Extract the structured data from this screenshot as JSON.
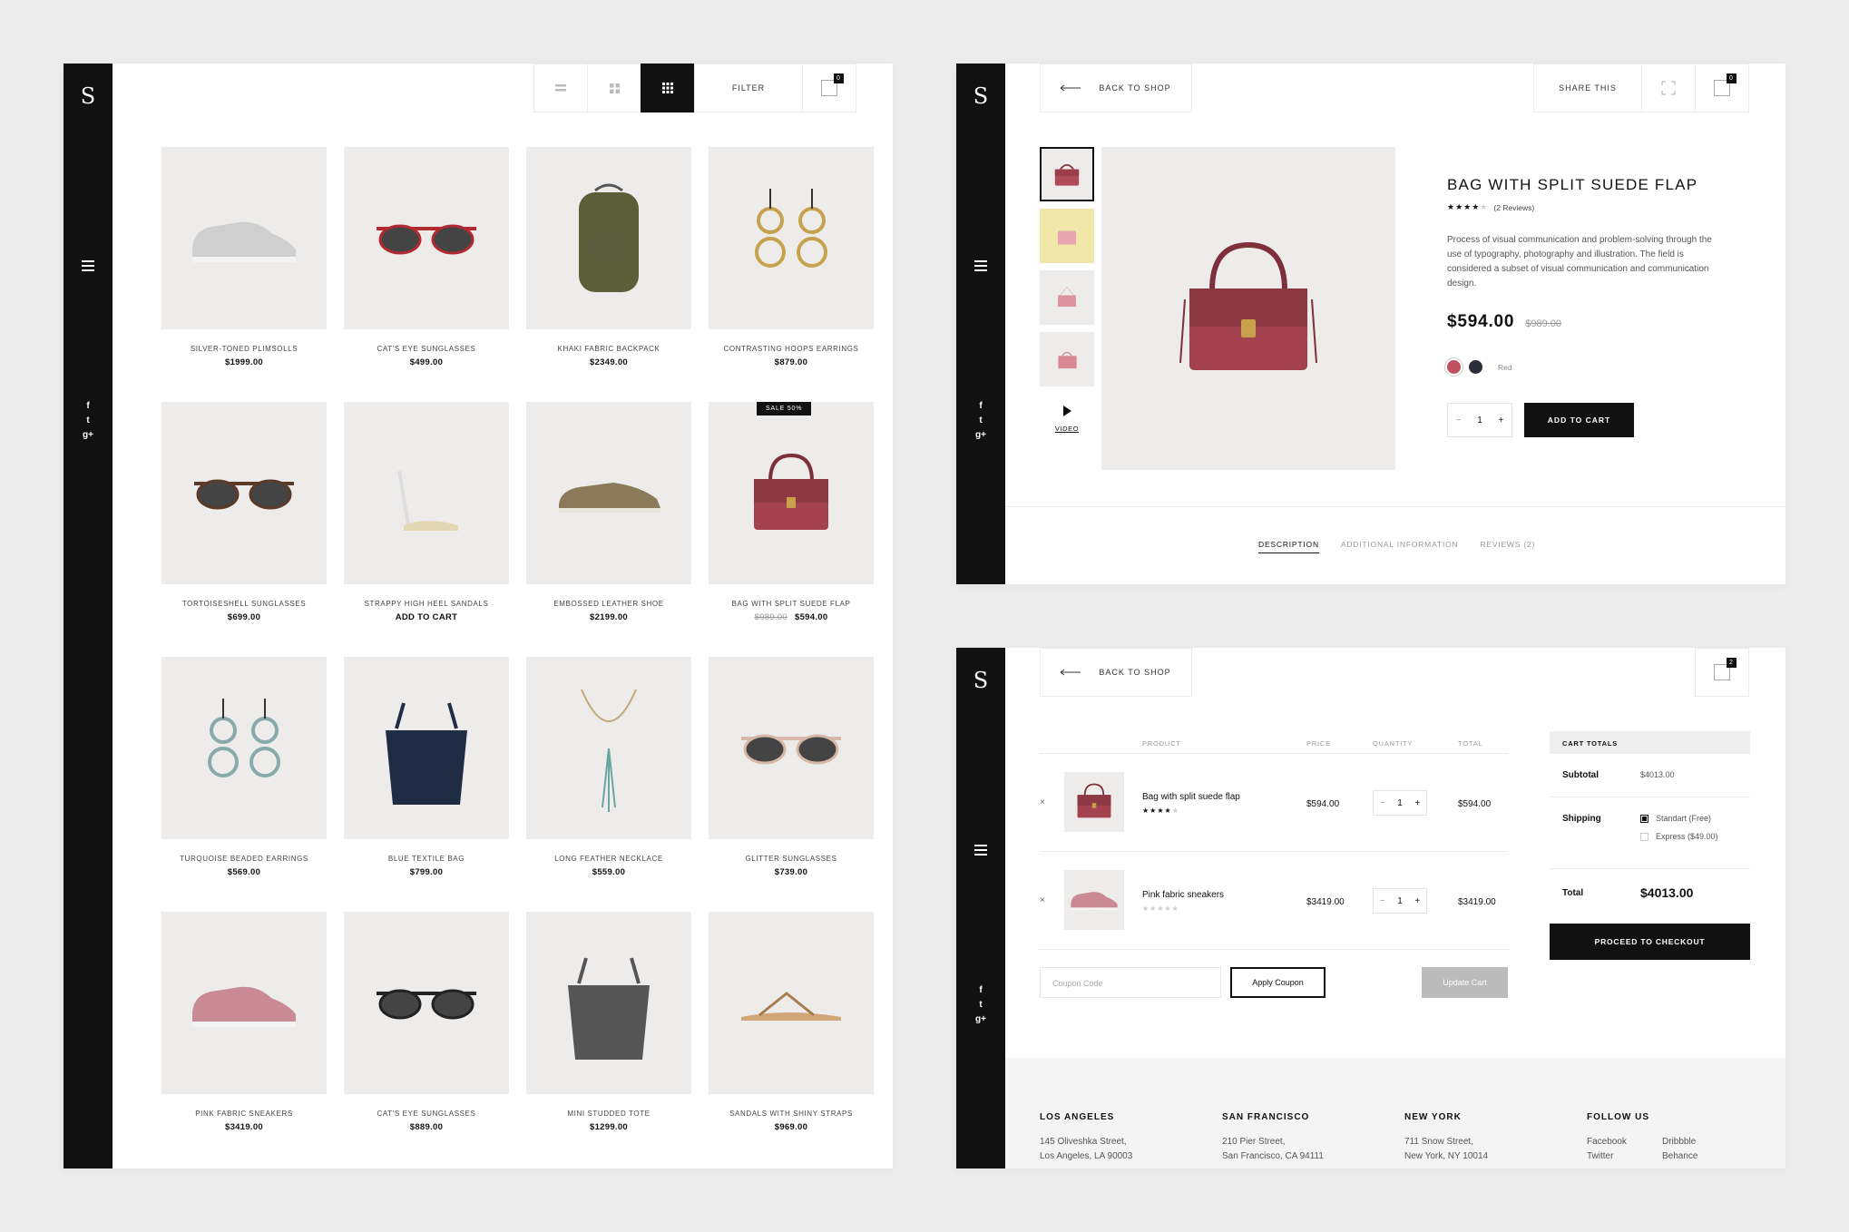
{
  "brand": {
    "logo": "S"
  },
  "social": [
    "f",
    "t",
    "g+"
  ],
  "shop": {
    "filter_label": "FILTER",
    "cart_count": "0",
    "products": [
      {
        "name": "SILVER-TONED PLIMSOLLS",
        "price": "$1999.00",
        "old_price": "",
        "badge": "",
        "icon": "sneaker"
      },
      {
        "name": "CAT'S EYE SUNGLASSES",
        "price": "$499.00",
        "old_price": "",
        "badge": "",
        "icon": "sunglasses"
      },
      {
        "name": "KHAKI FABRIC BACKPACK",
        "price": "$2349.00",
        "old_price": "",
        "badge": "",
        "icon": "backpack"
      },
      {
        "name": "CONTRASTING HOOPS EARRINGS",
        "price": "$879.00",
        "old_price": "",
        "badge": "",
        "icon": "earrings"
      },
      {
        "name": "TORTOISESHELL SUNGLASSES",
        "price": "$699.00",
        "old_price": "",
        "badge": "",
        "icon": "sunglasses"
      },
      {
        "name": "STRAPPY HIGH HEEL SANDALS",
        "price": "ADD TO CART",
        "old_price": "",
        "badge": "",
        "icon": "heel"
      },
      {
        "name": "EMBOSSED LEATHER SHOE",
        "price": "$2199.00",
        "old_price": "",
        "badge": "",
        "icon": "shoe"
      },
      {
        "name": "BAG WITH SPLIT SUEDE FLAP",
        "price": "$594.00",
        "old_price": "$989.00",
        "badge": "SALE 50%",
        "icon": "handbag"
      },
      {
        "name": "TURQUOISE BEADED EARRINGS",
        "price": "$569.00",
        "old_price": "",
        "badge": "",
        "icon": "earrings"
      },
      {
        "name": "BLUE TEXTILE BAG",
        "price": "$799.00",
        "old_price": "",
        "badge": "",
        "icon": "tote"
      },
      {
        "name": "LONG FEATHER NECKLACE",
        "price": "$559.00",
        "old_price": "",
        "badge": "",
        "icon": "necklace"
      },
      {
        "name": "GLITTER SUNGLASSES",
        "price": "$739.00",
        "old_price": "",
        "badge": "",
        "icon": "sunglasses"
      },
      {
        "name": "PINK FABRIC SNEAKERS",
        "price": "$3419.00",
        "old_price": "",
        "badge": "",
        "icon": "sneaker"
      },
      {
        "name": "CAT'S EYE SUNGLASSES",
        "price": "$889.00",
        "old_price": "",
        "badge": "",
        "icon": "sunglasses"
      },
      {
        "name": "MINI STUDDED TOTE",
        "price": "$1299.00",
        "old_price": "",
        "badge": "",
        "icon": "tote"
      },
      {
        "name": "SANDALS WITH SHINY STRAPS",
        "price": "$969.00",
        "old_price": "",
        "badge": "",
        "icon": "sandal"
      }
    ]
  },
  "detail": {
    "back_label": "BACK TO SHOP",
    "share_label": "SHARE THIS",
    "cart_count": "0",
    "title": "BAG WITH SPLIT SUEDE FLAP",
    "reviews": "(2 Reviews)",
    "rating": 4,
    "description": "Process of visual communication and problem-solving through the use of typography, photography and illustration. The field is considered a subset of visual communication and communication design.",
    "price": "$594.00",
    "old_price": "$989.00",
    "color_label": "Red",
    "colors": [
      "#c0505e",
      "#2a2e3a"
    ],
    "qty": "1",
    "add_to_cart": "ADD TO CART",
    "video_label": "VIDEO",
    "tabs": [
      "DESCRIPTION",
      "ADDITIONAL INFORMATION",
      "REVIEWS (2)"
    ]
  },
  "cart": {
    "back_label": "BACK TO SHOP",
    "cart_count": "2",
    "headers": {
      "product": "PRODUCT",
      "price": "PRICE",
      "quantity": "QUANTITY",
      "total": "TOTAL"
    },
    "items": [
      {
        "name": "Bag with split suede flap",
        "price": "$594.00",
        "qty": "1",
        "total": "$594.00",
        "rating": 4
      },
      {
        "name": "Pink fabric sneakers",
        "price": "$3419.00",
        "qty": "1",
        "total": "$3419.00",
        "rating": 0
      }
    ],
    "coupon_placeholder": "Coupon Code",
    "apply_coupon": "Apply Coupon",
    "update_cart": "Update Cart",
    "totals": {
      "heading": "CART TOTALS",
      "subtotal_label": "Subtotal",
      "subtotal": "$4013.00",
      "shipping_label": "Shipping",
      "shipping_options": [
        "Standart (Free)",
        "Express ($49.00)"
      ],
      "total_label": "Total",
      "total": "$4013.00",
      "checkout": "PROCEED TO CHECKOUT"
    },
    "footer": [
      {
        "city": "LOS ANGELES",
        "line1": "145 Oliveshka Street,",
        "line2": "Los Angeles, LA 90003"
      },
      {
        "city": "SAN FRANCISCO",
        "line1": "210 Pier Street,",
        "line2": "San Francisco, CA 94111"
      },
      {
        "city": "NEW YORK",
        "line1": "711 Snow Street,",
        "line2": "New York, NY 10014"
      }
    ],
    "follow": {
      "heading": "FOLLOW US",
      "links": [
        "Facebook",
        "Dribbble",
        "Twitter",
        "Behance"
      ]
    }
  }
}
